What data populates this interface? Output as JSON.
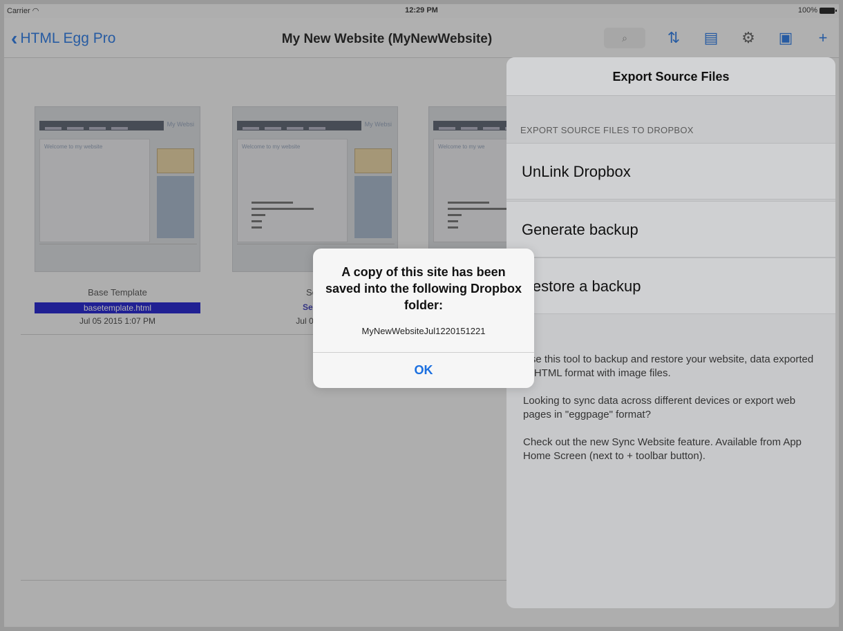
{
  "status_bar": {
    "carrier": "Carrier",
    "wifi_icon": "wifi-icon",
    "time": "12:29 PM",
    "battery": "100%"
  },
  "nav": {
    "back_label": "HTML Egg Pro",
    "title": "My New Website (MyNewWebsite)",
    "icons": [
      "search-icon",
      "sort-icon",
      "notes-icon",
      "gear-icon",
      "preview-icon",
      "plus-icon"
    ]
  },
  "templates": [
    {
      "title": "Base Template",
      "file": "basetemplate.html",
      "date": "Jul 05 2015 1:07 PM",
      "thumb_heading": "Welcome to my website"
    },
    {
      "title": "Sect",
      "file": "Sectio",
      "date": "Jul 05 201",
      "thumb_heading": "Welcome to my website"
    },
    {
      "title": "",
      "file": "",
      "date": "",
      "thumb_heading": "Welcome to my we"
    }
  ],
  "popover": {
    "title": "Export Source Files",
    "section_label": "EXPORT SOURCE FILES TO DROPBOX",
    "rows": [
      "UnLink Dropbox",
      "Generate backup",
      "Restore a backup"
    ],
    "description": [
      "Use this tool to backup and restore your website, data exported in HTML format with image files.",
      "Looking to sync data across different devices or export web pages in \"eggpage\" format?",
      "Check out the new Sync Website feature. Available from App Home Screen (next to + toolbar button)."
    ]
  },
  "alert": {
    "message": "A copy of this site has been saved into the following Dropbox folder:",
    "folder": "MyNewWebsiteJul1220151221",
    "ok_label": "OK"
  }
}
